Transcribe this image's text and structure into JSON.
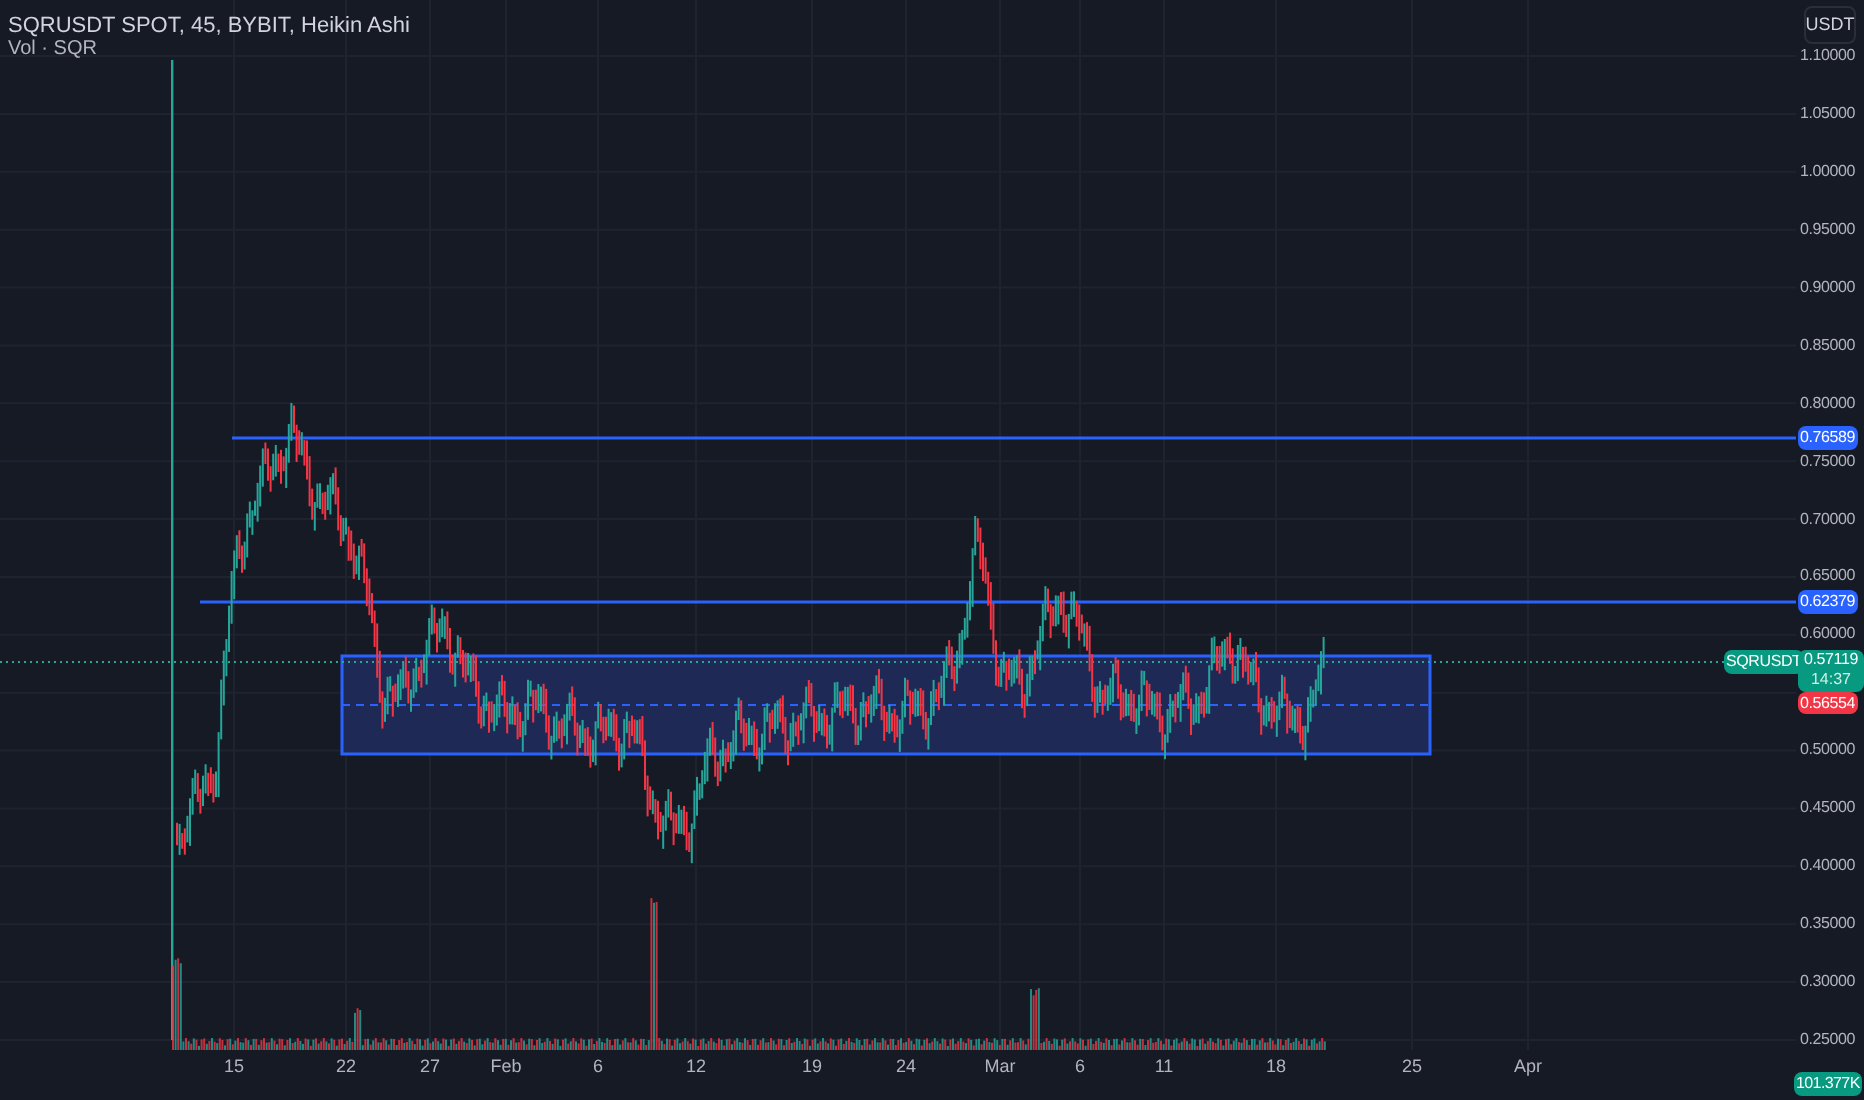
{
  "legend": {
    "title": "SQRUSDT SPOT, 45, BYBIT, Heikin Ashi",
    "indicator": "Vol · SQR"
  },
  "currency_button": "USDT",
  "price_axis": [
    "1.10000",
    "1.05000",
    "1.00000",
    "0.95000",
    "0.90000",
    "0.85000",
    "0.80000",
    "0.75000",
    "0.70000",
    "0.65000",
    "0.60000",
    "0.50000",
    "0.45000",
    "0.40000",
    "0.35000",
    "0.30000",
    "0.25000"
  ],
  "time_axis": [
    "15",
    "22",
    "27",
    "Feb",
    "6",
    "12",
    "19",
    "24",
    "Mar",
    "6",
    "11",
    "18",
    "25",
    "Apr"
  ],
  "level_tags": [
    "0.76589",
    "0.62379"
  ],
  "symbol_tag": "SQRUSDT",
  "last_price": "0.57119",
  "countdown": "14:37",
  "range_mid_price": "0.56554",
  "volume_tag": "101.377K"
}
